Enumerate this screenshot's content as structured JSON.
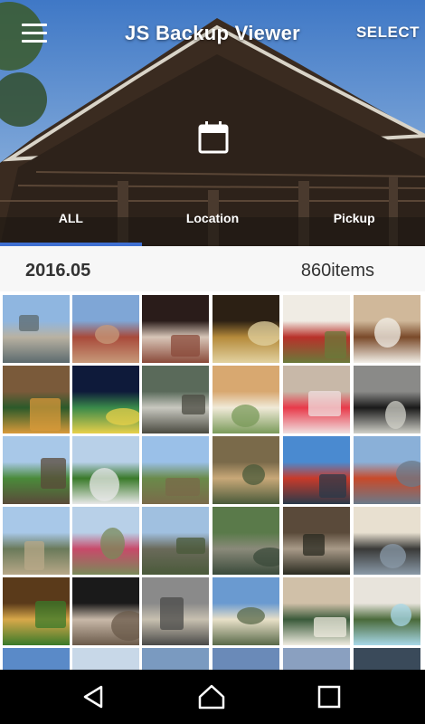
{
  "app": {
    "title": "JS Backup Viewer",
    "select_label": "SELECT"
  },
  "tabs": [
    {
      "label": "ALL"
    },
    {
      "label": "Location"
    },
    {
      "label": "Pickup"
    }
  ],
  "section": {
    "date": "2016.05",
    "count": "860items"
  },
  "colors": {
    "accent": "#3f6fd1",
    "navbar": "#000000"
  },
  "icons": {
    "menu": "hamburger-menu-icon",
    "calendar": "calendar-icon",
    "back": "back-triangle-icon",
    "home": "home-icon",
    "recents": "recents-square-icon"
  }
}
